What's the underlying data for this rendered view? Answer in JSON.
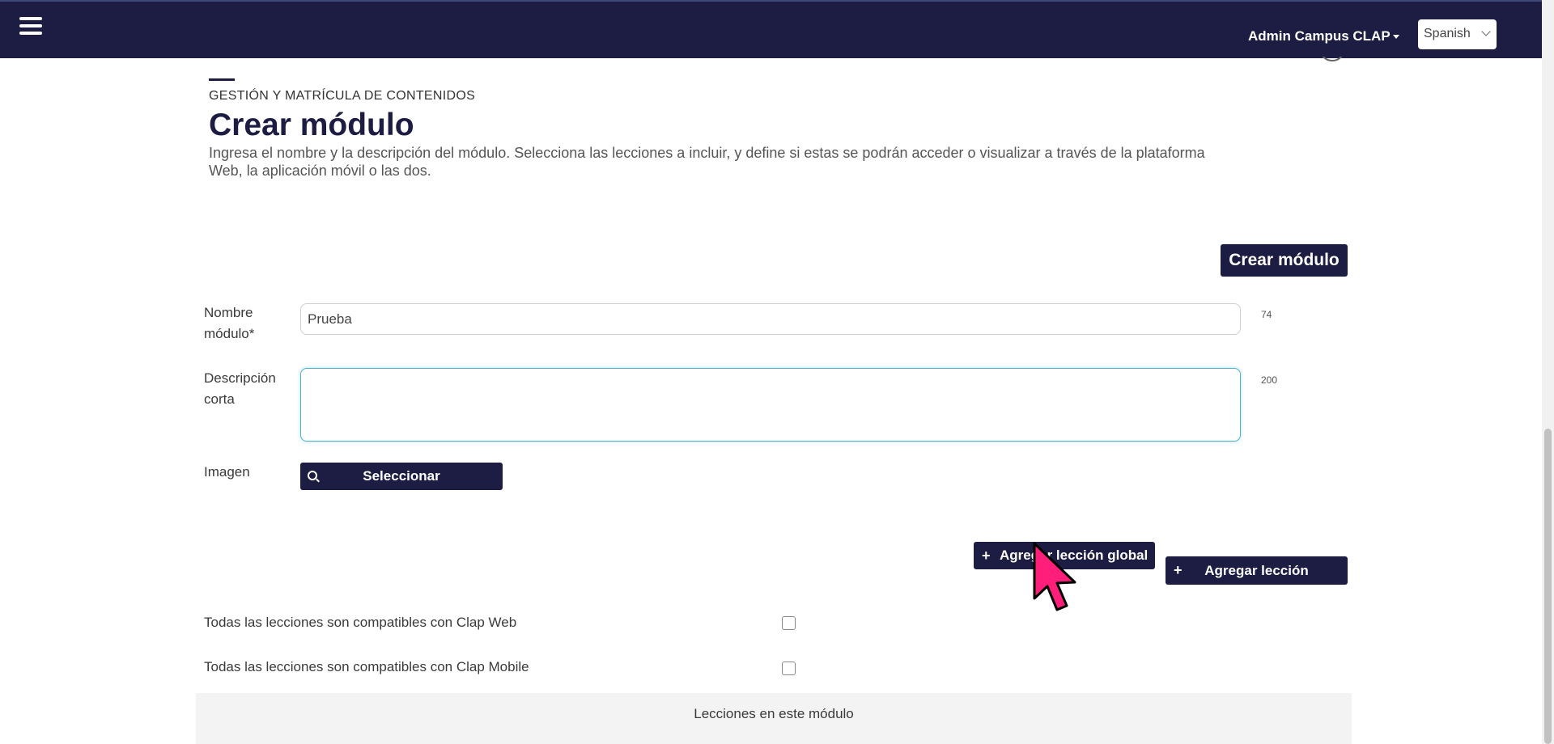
{
  "header": {
    "user_menu": "Admin Campus CLAP",
    "language": "Spanish",
    "colors": {
      "bar": "#1d1c42"
    }
  },
  "page": {
    "subtitle": "GESTIÓN Y MATRÍCULA DE CONTENIDOS",
    "title": "Crear módulo",
    "description": "Ingresa el nombre y la descripción del módulo. Selecciona las lecciones a incluir, y define si estas se podrán acceder o visualizar a través de la plataforma Web, la aplicación móvil o las dos."
  },
  "toolbar": {
    "create_label": "Crear módulo"
  },
  "form": {
    "name_label": "Nombre módulo*",
    "name_value": "Prueba",
    "name_counter": "74",
    "desc_label": "Descripción corta",
    "desc_value": "",
    "desc_counter": "200",
    "image_label": "Imagen",
    "select_button": "Seleccionar"
  },
  "lessons": {
    "add_global_label": "Agregar lección global",
    "add_label": "Agregar lección",
    "plus": "+",
    "web_compat_label": "Todas las lecciones son compatibles con Clap Web",
    "web_compat_checked": false,
    "mobile_compat_label": "Todas las lecciones son compatibles con Clap Mobile",
    "mobile_compat_checked": false,
    "section_title": "Lecciones en este módulo"
  },
  "icons": {
    "menu": "hamburger-menu-icon",
    "search": "search-icon",
    "cursor": "mouse-pointer-icon"
  },
  "colors": {
    "primary": "#1d1c42",
    "focus": "#4fb3c8",
    "cursor": "#ff1f7a"
  }
}
